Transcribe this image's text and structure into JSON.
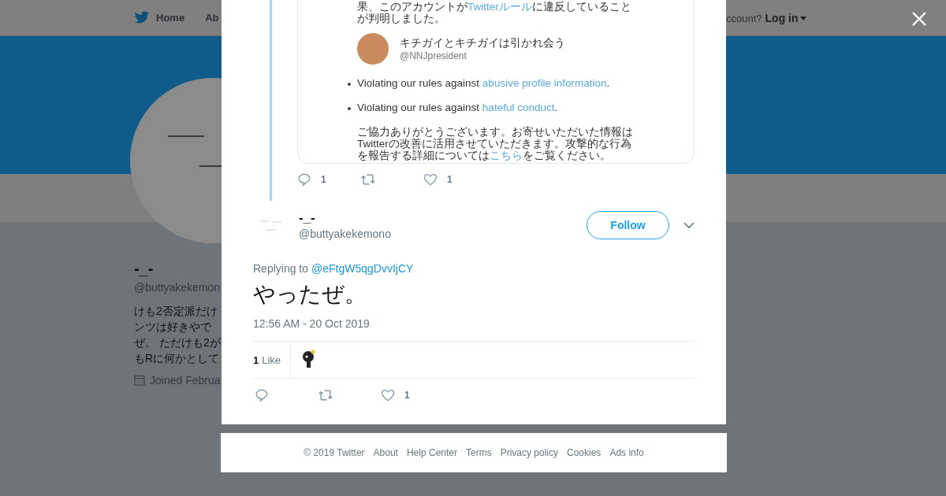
{
  "nav": {
    "items": [
      {
        "label": "Home"
      },
      {
        "label": "Ab"
      }
    ],
    "account_prompt": "ccount?",
    "login": "Log in"
  },
  "profile": {
    "name": "-_-",
    "handle": "@buttyakekemon",
    "bio": [
      "けも2否定派だけ",
      "ンツは好きやで",
      "ぜ。 ただけも2が",
      "もRに何かとして"
    ],
    "joined": "Joined Februa"
  },
  "parent_tweet": {
    "image": {
      "blocks": [
        {
          "kind": "text",
          "lines": [
            [
              {
                "text": "果、このアカウントが"
              },
              {
                "text": "Twitterルール",
                "link": true
              },
              {
                "text": "に違反していること"
              }
            ],
            [
              {
                "text": "が判明しました。"
              }
            ]
          ]
        },
        {
          "kind": "user",
          "name": "キチガイとキチガイは引かれ会う",
          "handle": "@NNJpresident"
        },
        {
          "kind": "bullet",
          "lines": [
            [
              {
                "text": "Violating our rules against "
              },
              {
                "text": "abusive profile information",
                "link": true
              },
              {
                "text": "."
              }
            ]
          ]
        },
        {
          "kind": "bullet",
          "lines": [
            [
              {
                "text": "Violating our rules against "
              },
              {
                "text": "hateful conduct",
                "link": true
              },
              {
                "text": "."
              }
            ]
          ]
        },
        {
          "kind": "text",
          "lines": [
            [
              {
                "text": "ご協力ありがとうございます。お寄せいただいた情報は"
              }
            ],
            [
              {
                "text": "Twitterの改善に活用させていただきます。攻撃的な行為"
              }
            ],
            [
              {
                "text": "を報告する詳細については"
              },
              {
                "text": "こちら",
                "link": true
              },
              {
                "text": "をご覧ください。"
              }
            ]
          ]
        }
      ]
    },
    "replies": "1",
    "likes": "1"
  },
  "tweet": {
    "name": "-_-",
    "handle": "@buttyakekemono",
    "follow": "Follow",
    "replying_label": "Replying to",
    "replying_to": "@eFtgW5qgDvvIjCY",
    "text": "やったぜ。",
    "timestamp": "12:56 AM - 20 Oct 2019",
    "like_count": "1",
    "like_label": "Like",
    "likes": "1"
  },
  "footer": {
    "links": [
      "© 2019 Twitter",
      "About",
      "Help Center",
      "Terms",
      "Privacy policy",
      "Cookies",
      "Ads info"
    ]
  }
}
